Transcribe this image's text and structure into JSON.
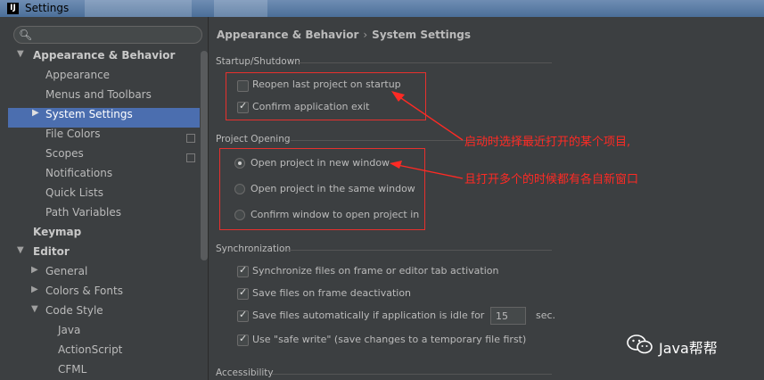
{
  "window": {
    "title": "Settings",
    "app_icon": "IJ"
  },
  "search": {
    "value": ""
  },
  "tree": {
    "items": [
      {
        "label": "Appearance & Behavior"
      },
      {
        "label": "Appearance"
      },
      {
        "label": "Menus and Toolbars"
      },
      {
        "label": "System Settings"
      },
      {
        "label": "File Colors"
      },
      {
        "label": "Scopes"
      },
      {
        "label": "Notifications"
      },
      {
        "label": "Quick Lists"
      },
      {
        "label": "Path Variables"
      },
      {
        "label": "Keymap"
      },
      {
        "label": "Editor"
      },
      {
        "label": "General"
      },
      {
        "label": "Colors & Fonts"
      },
      {
        "label": "Code Style"
      },
      {
        "label": "Java"
      },
      {
        "label": "ActionScript"
      },
      {
        "label": "CFML"
      }
    ]
  },
  "breadcrumb": {
    "parent": "Appearance & Behavior",
    "separator": "›",
    "current": "System Settings"
  },
  "sections": {
    "startup": {
      "title": "Startup/Shutdown",
      "reopen": {
        "label": "Reopen last project on startup",
        "checked": false
      },
      "confirm_exit": {
        "label": "Confirm application exit",
        "checked": true
      }
    },
    "opening": {
      "title": "Project Opening",
      "new_window": {
        "label": "Open project in new window",
        "selected": true
      },
      "same_window": {
        "label": "Open project in the same window",
        "selected": false
      },
      "confirm": {
        "label": "Confirm window to open project in",
        "selected": false
      }
    },
    "sync": {
      "title": "Synchronization",
      "sync_files": {
        "label": "Synchronize files on frame or editor tab activation",
        "checked": true
      },
      "save_deactivation": {
        "label": "Save files on frame deactivation",
        "checked": true
      },
      "save_idle": {
        "label": "Save files automatically if application is idle for",
        "checked": true,
        "value": "15",
        "unit": "sec."
      },
      "safe_write": {
        "label": "Use \"safe write\" (save changes to a temporary file first)",
        "checked": true
      }
    },
    "accessibility": {
      "title": "Accessibility"
    }
  },
  "annotations": {
    "note1": "启动时选择最近打开的某个项目,",
    "note2": "且打开多个的时候都有各自新窗口",
    "color": "#ff2a24"
  },
  "watermark": {
    "text": "Java帮帮"
  },
  "colors": {
    "selection": "#4b6eaf",
    "background": "#3c3f41"
  }
}
